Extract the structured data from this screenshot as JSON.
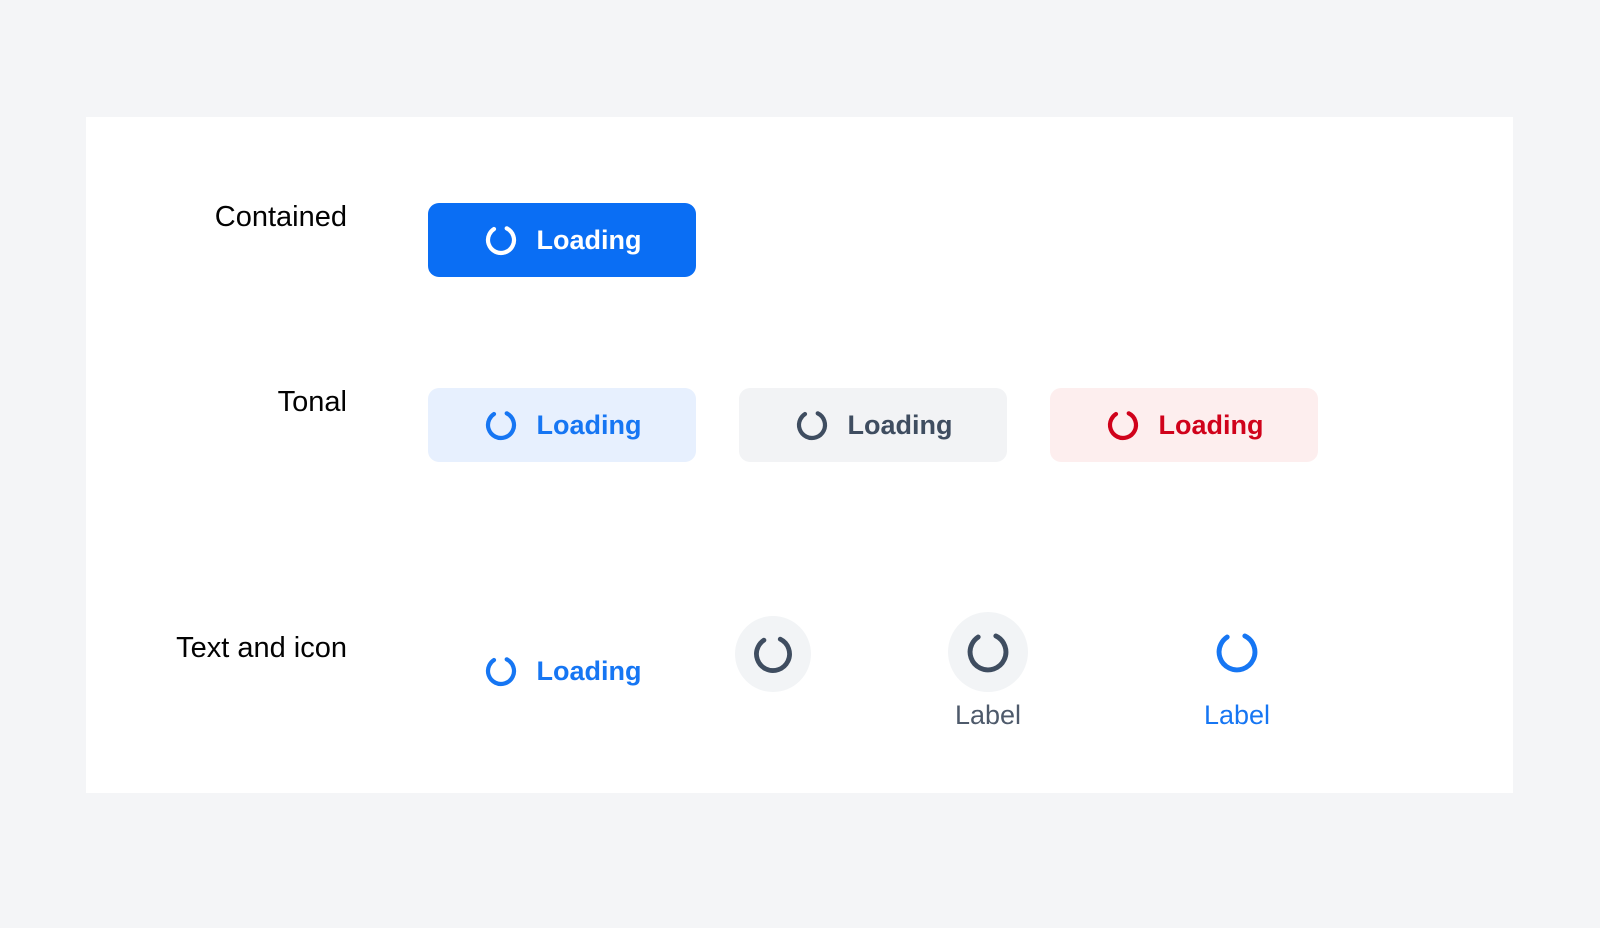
{
  "page": {
    "background_color": "#f4f5f7",
    "card_background_color": "#ffffff"
  },
  "colors": {
    "primary_blue": "#0a6ef4",
    "link_blue": "#1676f3",
    "tonal_blue_bg": "#e7f0fe",
    "tonal_gray_bg": "#f2f3f5",
    "tonal_red_bg": "#fdeeee",
    "slate": "#3f4d60",
    "slate_label": "#4e5a6b",
    "red": "#d0021b",
    "icon_circle_bg": "#f2f4f6",
    "white": "#ffffff",
    "row_label": "#020202"
  },
  "rows": [
    {
      "label": "Contained",
      "items": [
        {
          "kind": "button",
          "variant": "contained-blue",
          "icon": "loading-spinner-icon",
          "label": "Loading"
        }
      ]
    },
    {
      "label": "Tonal",
      "items": [
        {
          "kind": "button",
          "variant": "tonal-blue",
          "icon": "loading-spinner-icon",
          "label": "Loading"
        },
        {
          "kind": "button",
          "variant": "tonal-gray",
          "icon": "loading-spinner-icon",
          "label": "Loading"
        },
        {
          "kind": "button",
          "variant": "tonal-red",
          "icon": "loading-spinner-icon",
          "label": "Loading"
        }
      ]
    },
    {
      "label": "Text and icon",
      "items": [
        {
          "kind": "button",
          "variant": "text-blue",
          "icon": "loading-spinner-icon",
          "label": "Loading"
        },
        {
          "kind": "icon-button",
          "variant": "circle-gray-filled",
          "icon": "loading-spinner-icon",
          "label": ""
        },
        {
          "kind": "icon-button",
          "variant": "circle-gray-filled-labeled",
          "icon": "loading-spinner-icon",
          "label": "Label"
        },
        {
          "kind": "icon-button",
          "variant": "circle-plain-blue-labeled",
          "icon": "loading-spinner-icon",
          "label": "Label"
        }
      ]
    }
  ]
}
